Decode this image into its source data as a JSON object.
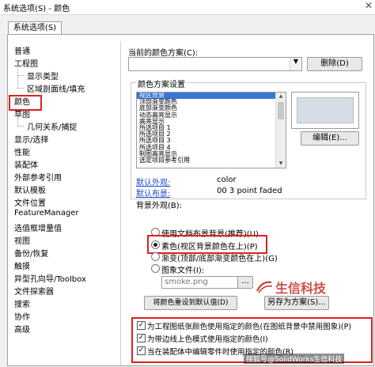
{
  "window": {
    "title": "系统选项(S) - 颜色",
    "close_glyph": "✕"
  },
  "tabs": [
    "系统选项(S)"
  ],
  "tree": [
    {
      "label": "普通",
      "level": 0
    },
    {
      "label": "工程图",
      "level": 0
    },
    {
      "label": "显示类型",
      "level": 1
    },
    {
      "label": "区域剖面线/填充",
      "level": 1
    },
    {
      "label": "颜色",
      "level": 0,
      "selected": true
    },
    {
      "label": "草图",
      "level": 0
    },
    {
      "label": "几何关系/捕捉",
      "level": 1
    },
    {
      "label": "显示/选择",
      "level": 0
    },
    {
      "label": "性能",
      "level": 0
    },
    {
      "label": "装配体",
      "level": 0
    },
    {
      "label": "外部参考引用",
      "level": 0
    },
    {
      "label": "默认模板",
      "level": 0
    },
    {
      "label": "文件位置",
      "level": 0
    },
    {
      "label": "FeatureManager",
      "level": 0
    },
    {
      "label": "选值框增量值",
      "level": 0
    },
    {
      "label": "视图",
      "level": 0
    },
    {
      "label": "备份/恢复",
      "level": 0
    },
    {
      "label": "触摸",
      "level": 0
    },
    {
      "label": "异型孔向导/Toolbox",
      "level": 0
    },
    {
      "label": "文件探索器",
      "level": 0
    },
    {
      "label": "搜索",
      "level": 0
    },
    {
      "label": "协作",
      "level": 0
    },
    {
      "label": "高级",
      "level": 0
    }
  ],
  "scheme": {
    "label": "当前的颜色方案(C):",
    "value": "",
    "delete_button": "删除(D)"
  },
  "settings": {
    "label": "颜色方案设置",
    "items": [
      "视区背景",
      "顶部渐变颜色",
      "底部渐变颜色",
      "动态高亮显示",
      "高亮显示",
      "所选项目 1",
      "所选项目 2",
      "所选项目 3",
      "所选项目 4",
      "制图高亮显示",
      "选定项目参考引用"
    ],
    "selected_index": 0,
    "edit_button": "编辑(E)..."
  },
  "defaults": {
    "appearance_label": "默认外观:",
    "appearance_value": "color",
    "scene_label": "默认布景:",
    "scene_value": "00 3 point faded"
  },
  "background": {
    "label": "背景外观(B):",
    "options": [
      {
        "label": "使用文档布景背景(推荐)(U)",
        "checked": false
      },
      {
        "label": "素色(视区背景颜色在上)(P)",
        "checked": true
      },
      {
        "label": "渐变(顶部/底部渐变颜色在上)(G)",
        "checked": false
      },
      {
        "label": "图象文件(I):",
        "checked": false
      }
    ],
    "image_file": "smoke.png",
    "browse": "..."
  },
  "buttons": {
    "reset": "将颜色重设到默认值(D)",
    "save_as": "另存为方案(S)..."
  },
  "checkboxes": [
    {
      "label": "为工程图纸张颜色使用指定的颜色(在图纸背景中禁用图象)(P)",
      "checked": true
    },
    {
      "label": "为带边线上色模式使用指定的颜色(I)",
      "checked": true
    },
    {
      "label": "当在装配体中编辑零件时使用指定的颜色(R)",
      "checked": true
    }
  ],
  "watermark": {
    "text": "生信科技",
    "caption": "搜狐号@SolidWorks生信科技"
  }
}
